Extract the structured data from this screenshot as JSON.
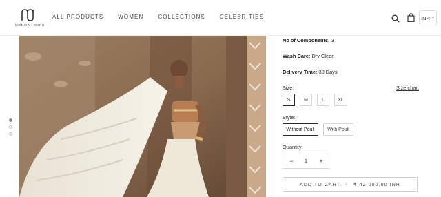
{
  "header": {
    "logo_text": "MONIKA • NIDHII",
    "nav": [
      "ALL PRODUCTS",
      "WOMEN",
      "COLLECTIONS",
      "CELEBRITIES"
    ],
    "currency": "INR",
    "icons": {
      "search": "search-icon",
      "bag": "shopping-bag-icon",
      "caret": "chevron-down-icon"
    }
  },
  "gallery": {
    "dots": 3,
    "active_dot": 0
  },
  "details": {
    "components_label": "No of Components:",
    "components_value": " 3",
    "wash_label": "Wash Care:",
    "wash_value": " Dry Clean",
    "delivery_label": "Delivery Time:",
    "delivery_value": " 30 Days",
    "size_label": "Size:",
    "size_chart": "Size chart",
    "sizes": [
      "S",
      "M",
      "L",
      "XL"
    ],
    "selected_size": "S",
    "style_label": "Style:",
    "styles": [
      "Without Pouli",
      "With Pouli"
    ],
    "selected_style": "Without Pouli",
    "quantity_label": "Quantity:",
    "quantity": "1",
    "minus": "−",
    "plus": "+",
    "add_to_cart": "ADD TO CART",
    "separator": "•",
    "price": "₹ 42,000.00 INR"
  }
}
